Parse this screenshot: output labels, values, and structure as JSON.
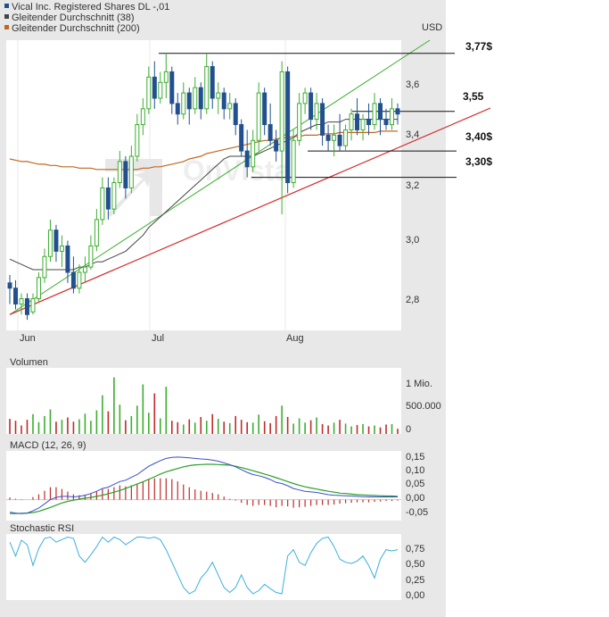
{
  "colors": {
    "up": "#3cae2f",
    "down": "#22508e",
    "vol_up": "#3cae2f",
    "vol_down": "#c22a2a",
    "sma38": "#444444",
    "sma200": "#c06820",
    "trend_green": "#3cae2f",
    "trend_red": "#d22a2a",
    "macd_line": "#3c4ec8",
    "signal_line": "#2aa02a",
    "hist_pos": "#c22a2a",
    "rsi_line": "#3aaee0",
    "panel_bg": "#ffffff",
    "frame_bg": "#e8e8e8",
    "grid": "#e8e8e8"
  },
  "legend": [
    {
      "label": "Vical Inc. Registered Shares DL -,01",
      "color": "#22508e"
    },
    {
      "label": "Gleitender Durchschnitt (38)",
      "color": "#444444"
    },
    {
      "label": "Gleitender Durchschnitt (200)",
      "color": "#c06820"
    }
  ],
  "watermark": "OnVista",
  "chart_data": [
    {
      "type": "candlestick",
      "currency": "USD",
      "ylim": [
        2.72,
        3.82
      ],
      "yticks": [
        "2,8",
        "3,0",
        "3,2",
        "3,4",
        "3,6"
      ],
      "xticks": [
        "Jun",
        "Jul",
        "Aug"
      ],
      "price_labels": [
        "3,77$",
        "3,55",
        "3,40$",
        "3,30$"
      ],
      "levels": [
        {
          "label": "3,77$",
          "value": 3.77
        },
        {
          "label": "3,55",
          "value": 3.55
        },
        {
          "label": "3,40$",
          "value": 3.4
        },
        {
          "label": "3,30$",
          "value": 3.3
        }
      ],
      "candles": [
        [
          2.9,
          2.93,
          2.82,
          2.88
        ],
        [
          2.88,
          2.91,
          2.8,
          2.82
        ],
        [
          2.82,
          2.86,
          2.78,
          2.84
        ],
        [
          2.84,
          2.86,
          2.76,
          2.78
        ],
        [
          2.79,
          2.86,
          2.78,
          2.84
        ],
        [
          2.84,
          2.94,
          2.83,
          2.92
        ],
        [
          2.92,
          3.03,
          2.9,
          3.0
        ],
        [
          3.0,
          3.14,
          2.98,
          3.1
        ],
        [
          3.1,
          3.12,
          2.98,
          3.02
        ],
        [
          3.02,
          3.08,
          2.96,
          3.04
        ],
        [
          3.04,
          3.06,
          2.9,
          2.94
        ],
        [
          2.94,
          3.0,
          2.86,
          2.88
        ],
        [
          2.88,
          2.97,
          2.86,
          2.94
        ],
        [
          2.94,
          3.0,
          2.9,
          2.96
        ],
        [
          2.96,
          3.08,
          2.95,
          3.04
        ],
        [
          3.04,
          3.18,
          3.02,
          3.14
        ],
        [
          3.14,
          3.3,
          3.12,
          3.26
        ],
        [
          3.26,
          3.3,
          3.14,
          3.18
        ],
        [
          3.18,
          3.3,
          3.16,
          3.28
        ],
        [
          3.28,
          3.4,
          3.26,
          3.36
        ],
        [
          3.36,
          3.38,
          3.22,
          3.26
        ],
        [
          3.26,
          3.42,
          3.24,
          3.38
        ],
        [
          3.38,
          3.54,
          3.36,
          3.5
        ],
        [
          3.5,
          3.6,
          3.46,
          3.56
        ],
        [
          3.56,
          3.72,
          3.54,
          3.68
        ],
        [
          3.68,
          3.74,
          3.56,
          3.6
        ],
        [
          3.6,
          3.7,
          3.58,
          3.66
        ],
        [
          3.66,
          3.77,
          3.6,
          3.7
        ],
        [
          3.7,
          3.72,
          3.54,
          3.58
        ],
        [
          3.58,
          3.62,
          3.5,
          3.54
        ],
        [
          3.54,
          3.66,
          3.52,
          3.62
        ],
        [
          3.62,
          3.64,
          3.5,
          3.56
        ],
        [
          3.56,
          3.68,
          3.54,
          3.64
        ],
        [
          3.64,
          3.66,
          3.52,
          3.56
        ],
        [
          3.56,
          3.77,
          3.54,
          3.72
        ],
        [
          3.72,
          3.74,
          3.56,
          3.6
        ],
        [
          3.6,
          3.66,
          3.54,
          3.62
        ],
        [
          3.62,
          3.64,
          3.52,
          3.56
        ],
        [
          3.56,
          3.62,
          3.52,
          3.58
        ],
        [
          3.58,
          3.6,
          3.46,
          3.5
        ],
        [
          3.5,
          3.52,
          3.38,
          3.4
        ],
        [
          3.4,
          3.48,
          3.3,
          3.34
        ],
        [
          3.34,
          3.48,
          3.32,
          3.44
        ],
        [
          3.44,
          3.66,
          3.4,
          3.62
        ],
        [
          3.62,
          3.64,
          3.46,
          3.5
        ],
        [
          3.5,
          3.58,
          3.42,
          3.44
        ],
        [
          3.44,
          3.48,
          3.36,
          3.4
        ],
        [
          3.4,
          3.74,
          3.16,
          3.7
        ],
        [
          3.7,
          3.72,
          3.24,
          3.28
        ],
        [
          3.28,
          3.48,
          3.26,
          3.44
        ],
        [
          3.44,
          3.62,
          3.42,
          3.58
        ],
        [
          3.58,
          3.64,
          3.54,
          3.62
        ],
        [
          3.62,
          3.64,
          3.48,
          3.52
        ],
        [
          3.52,
          3.62,
          3.48,
          3.58
        ],
        [
          3.58,
          3.6,
          3.42,
          3.46
        ],
        [
          3.46,
          3.5,
          3.4,
          3.44
        ],
        [
          3.44,
          3.5,
          3.38,
          3.46
        ],
        [
          3.46,
          3.54,
          3.4,
          3.42
        ],
        [
          3.42,
          3.5,
          3.4,
          3.48
        ],
        [
          3.48,
          3.56,
          3.44,
          3.54
        ],
        [
          3.54,
          3.6,
          3.46,
          3.48
        ],
        [
          3.48,
          3.54,
          3.44,
          3.52
        ],
        [
          3.52,
          3.58,
          3.46,
          3.5
        ],
        [
          3.5,
          3.62,
          3.48,
          3.58
        ],
        [
          3.58,
          3.6,
          3.46,
          3.52
        ],
        [
          3.52,
          3.56,
          3.48,
          3.5
        ],
        [
          3.5,
          3.6,
          3.48,
          3.56
        ],
        [
          3.56,
          3.58,
          3.5,
          3.54
        ]
      ],
      "sma38": [
        2.99,
        2.98,
        2.97,
        2.96,
        2.95,
        2.95,
        2.95,
        2.95,
        2.95,
        2.95,
        2.95,
        2.95,
        2.96,
        2.96,
        2.97,
        2.98,
        2.98,
        2.99,
        3.0,
        3.01,
        3.02,
        3.04,
        3.06,
        3.08,
        3.11,
        3.13,
        3.15,
        3.17,
        3.19,
        3.21,
        3.23,
        3.25,
        3.27,
        3.29,
        3.31,
        3.33,
        3.35,
        3.37,
        3.38,
        3.38,
        3.38,
        3.38,
        3.38,
        3.39,
        3.4,
        3.41,
        3.42,
        3.43,
        3.44,
        3.45,
        3.47,
        3.48,
        3.49,
        3.5,
        3.5,
        3.51,
        3.51,
        3.51,
        3.52,
        3.52,
        3.52,
        3.52,
        3.52,
        3.52,
        3.52,
        3.52,
        3.52,
        3.52
      ],
      "sma200": [
        3.37,
        3.365,
        3.36,
        3.36,
        3.355,
        3.35,
        3.35,
        3.345,
        3.345,
        3.34,
        3.34,
        3.34,
        3.335,
        3.335,
        3.335,
        3.33,
        3.33,
        3.33,
        3.33,
        3.33,
        3.33,
        3.33,
        3.33,
        3.335,
        3.335,
        3.34,
        3.34,
        3.345,
        3.35,
        3.355,
        3.36,
        3.37,
        3.375,
        3.38,
        3.39,
        3.395,
        3.4,
        3.405,
        3.41,
        3.415,
        3.42,
        3.425,
        3.43,
        3.435,
        3.44,
        3.44,
        3.445,
        3.45,
        3.45,
        3.455,
        3.455,
        3.46,
        3.46,
        3.46,
        3.465,
        3.465,
        3.465,
        3.47,
        3.47,
        3.47,
        3.47,
        3.47,
        3.47,
        3.47,
        3.475,
        3.475,
        3.475,
        3.475
      ],
      "trend_green": {
        "from": [
          0,
          2.78
        ],
        "to": [
          67,
          3.8
        ]
      },
      "trend_red": {
        "from": [
          0,
          2.78
        ],
        "to": [
          67,
          3.46
        ]
      }
    },
    {
      "type": "bar",
      "title": "Volumen",
      "ylim": [
        0,
        1400000
      ],
      "yticks": [
        "1 Mio.",
        "500.000",
        "0"
      ],
      "values": [
        320000,
        280000,
        180000,
        300000,
        420000,
        250000,
        380000,
        520000,
        260000,
        300000,
        350000,
        260000,
        310000,
        430000,
        280000,
        500000,
        820000,
        480000,
        1200000,
        620000,
        290000,
        380000,
        600000,
        1050000,
        450000,
        860000,
        330000,
        1000000,
        280000,
        250000,
        200000,
        310000,
        240000,
        360000,
        280000,
        420000,
        320000,
        260000,
        230000,
        380000,
        300000,
        250000,
        240000,
        410000,
        270000,
        230000,
        380000,
        600000,
        360000,
        220000,
        330000,
        240000,
        290000,
        350000,
        210000,
        180000,
        240000,
        300000,
        220000,
        160000,
        190000,
        210000,
        160000,
        180000,
        140000,
        200000,
        210000,
        110000
      ],
      "up": [
        0,
        0,
        0,
        0,
        1,
        1,
        1,
        1,
        0,
        1,
        0,
        0,
        1,
        1,
        1,
        1,
        1,
        0,
        1,
        1,
        0,
        1,
        1,
        1,
        1,
        0,
        1,
        1,
        0,
        0,
        1,
        0,
        1,
        0,
        1,
        0,
        1,
        0,
        1,
        0,
        0,
        0,
        1,
        1,
        0,
        0,
        0,
        1,
        0,
        1,
        1,
        1,
        0,
        1,
        0,
        0,
        1,
        0,
        1,
        1,
        0,
        1,
        0,
        1,
        0,
        0,
        1,
        0
      ]
    },
    {
      "type": "line",
      "title": "MACD (12, 26, 9)",
      "ylim": [
        -0.075,
        0.175
      ],
      "yticks": [
        "0,15",
        "0,10",
        "0,05",
        "0,00",
        "-0,05"
      ],
      "macd": [
        -0.045,
        -0.048,
        -0.05,
        -0.048,
        -0.04,
        -0.03,
        -0.015,
        0.0,
        0.008,
        0.012,
        0.012,
        0.01,
        0.012,
        0.016,
        0.022,
        0.03,
        0.04,
        0.045,
        0.055,
        0.065,
        0.07,
        0.08,
        0.09,
        0.105,
        0.12,
        0.13,
        0.14,
        0.148,
        0.152,
        0.153,
        0.152,
        0.15,
        0.148,
        0.146,
        0.145,
        0.142,
        0.138,
        0.132,
        0.126,
        0.118,
        0.108,
        0.098,
        0.09,
        0.086,
        0.08,
        0.072,
        0.062,
        0.058,
        0.05,
        0.04,
        0.035,
        0.03,
        0.028,
        0.026,
        0.022,
        0.018,
        0.016,
        0.015,
        0.014,
        0.013,
        0.012,
        0.011,
        0.01,
        0.01,
        0.01,
        0.01,
        0.01,
        0.01
      ],
      "signal": [
        -0.05,
        -0.05,
        -0.049,
        -0.048,
        -0.046,
        -0.042,
        -0.035,
        -0.028,
        -0.02,
        -0.012,
        -0.006,
        -0.002,
        0.002,
        0.005,
        0.008,
        0.012,
        0.016,
        0.021,
        0.027,
        0.033,
        0.04,
        0.048,
        0.056,
        0.064,
        0.073,
        0.082,
        0.092,
        0.1,
        0.106,
        0.112,
        0.118,
        0.122,
        0.125,
        0.126,
        0.127,
        0.127,
        0.126,
        0.125,
        0.124,
        0.12,
        0.115,
        0.11,
        0.104,
        0.098,
        0.092,
        0.086,
        0.079,
        0.072,
        0.065,
        0.058,
        0.052,
        0.046,
        0.042,
        0.038,
        0.034,
        0.03,
        0.027,
        0.024,
        0.022,
        0.02,
        0.018,
        0.017,
        0.016,
        0.015,
        0.014,
        0.013,
        0.013,
        0.012
      ]
    },
    {
      "type": "line",
      "title": "Stochastic RSI",
      "ylim": [
        -0.1,
        0.95
      ],
      "yticks": [
        "0,75",
        "0,50",
        "0,25",
        "0,00"
      ],
      "values": [
        0.82,
        0.6,
        0.85,
        0.78,
        0.45,
        0.72,
        0.88,
        0.9,
        0.82,
        0.86,
        0.9,
        0.88,
        0.6,
        0.5,
        0.62,
        0.75,
        0.9,
        0.82,
        0.9,
        0.86,
        0.78,
        0.84,
        0.9,
        0.9,
        0.88,
        0.9,
        0.86,
        0.7,
        0.5,
        0.3,
        0.1,
        0.0,
        0.05,
        0.25,
        0.35,
        0.5,
        0.3,
        0.1,
        0.02,
        0.1,
        0.3,
        0.1,
        0.0,
        0.05,
        0.15,
        0.08,
        0.02,
        0.0,
        0.6,
        0.7,
        0.5,
        0.45,
        0.65,
        0.8,
        0.88,
        0.9,
        0.75,
        0.55,
        0.5,
        0.48,
        0.52,
        0.6,
        0.45,
        0.25,
        0.55,
        0.7,
        0.68,
        0.7
      ]
    }
  ]
}
